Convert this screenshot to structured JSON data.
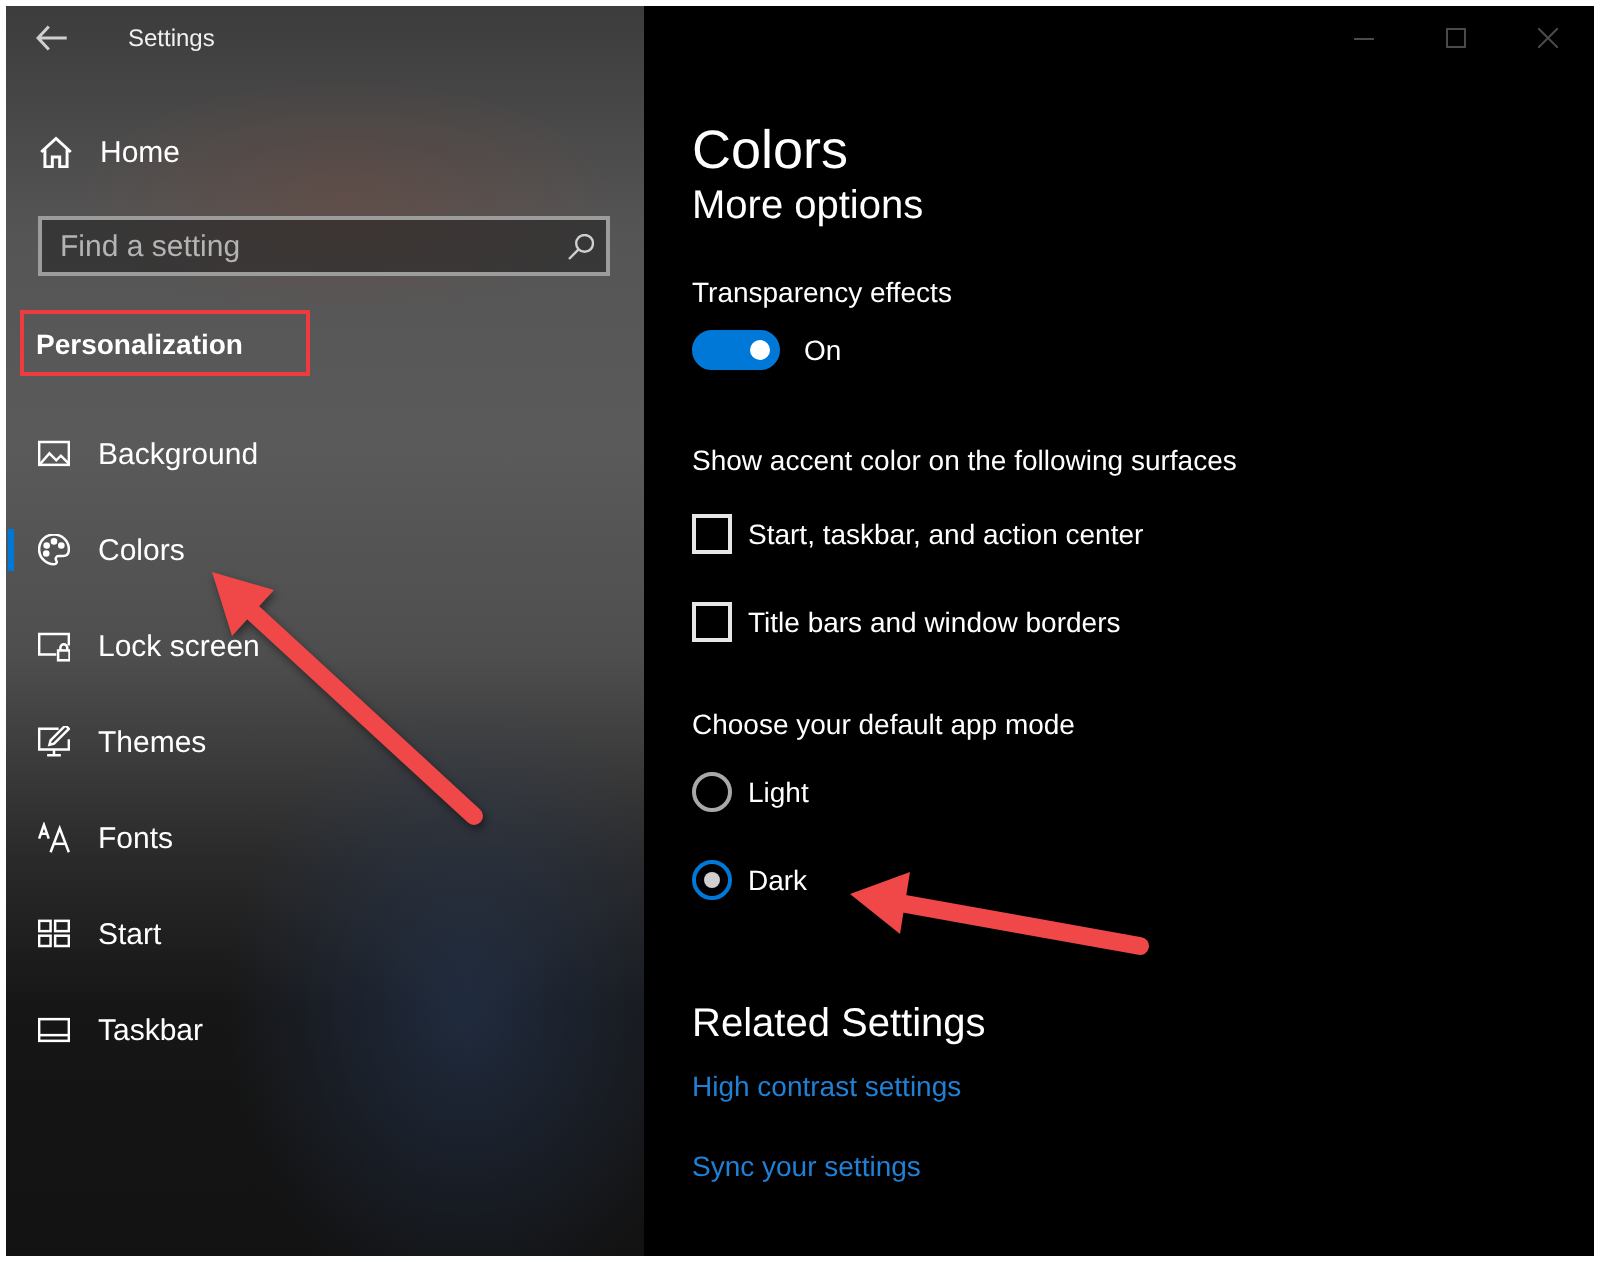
{
  "window": {
    "title": "Settings"
  },
  "sidebar": {
    "home": {
      "label": "Home"
    },
    "search": {
      "placeholder": "Find a setting"
    },
    "section": {
      "label": "Personalization",
      "highlighted": true
    },
    "items": [
      {
        "label": "Background",
        "selected": false
      },
      {
        "label": "Colors",
        "selected": true
      },
      {
        "label": "Lock screen",
        "selected": false
      },
      {
        "label": "Themes",
        "selected": false
      },
      {
        "label": "Fonts",
        "selected": false
      },
      {
        "label": "Start",
        "selected": false
      },
      {
        "label": "Taskbar",
        "selected": false
      }
    ]
  },
  "content": {
    "title": "Colors",
    "subtitle": "More options",
    "transparency": {
      "label": "Transparency effects",
      "on": true,
      "state_text": "On"
    },
    "accent": {
      "label": "Show accent color on the following surfaces",
      "options": [
        {
          "label": "Start, taskbar, and action center",
          "checked": false
        },
        {
          "label": "Title bars and window borders",
          "checked": false
        }
      ]
    },
    "app_mode": {
      "label": "Choose your default app mode",
      "options": [
        {
          "label": "Light",
          "selected": false
        },
        {
          "label": "Dark",
          "selected": true
        }
      ]
    },
    "related": {
      "title": "Related Settings",
      "links": [
        "High contrast settings",
        "Sync your settings"
      ]
    }
  }
}
